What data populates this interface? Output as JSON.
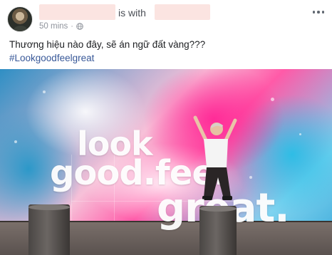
{
  "post": {
    "with_text": "is with",
    "timestamp": "50 mins",
    "separator": "·",
    "privacy_icon": "globe-icon",
    "more_icon": "more-options-icon",
    "caption": "Thương hiệu nào đây, sẽ án ngữ đất vàng???",
    "hashtag": "#Lookgoodfeelgreat"
  },
  "photo": {
    "sign_line1": "look",
    "sign_line2": "good.feel",
    "sign_line3": "great."
  },
  "colors": {
    "hashtag": "#385898",
    "meta": "#90949c",
    "redacted": "#fbe4e1"
  }
}
